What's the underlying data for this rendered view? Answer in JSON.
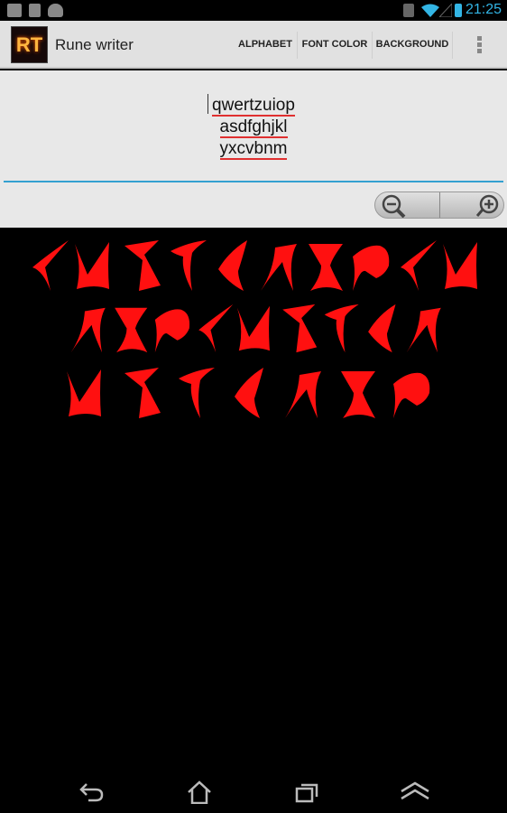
{
  "status_bar": {
    "time": "21:25",
    "icons": [
      "notes-icon",
      "sd-card-icon",
      "android-icon",
      "mute-icon",
      "wifi-icon",
      "signal-icon",
      "battery-charging-icon"
    ]
  },
  "action_bar": {
    "logo_text": "RT",
    "title": "Rune writer",
    "menu": [
      "ALPHABET",
      "FONT COLOR",
      "BACKGROUND"
    ],
    "overflow_icon": "more-vert-icon"
  },
  "editor": {
    "lines": [
      "qwertzuiop",
      "asdfghjkl",
      "yxcvbnm"
    ]
  },
  "zoom": {
    "out_icon": "zoom-out-icon",
    "in_icon": "zoom-in-icon"
  },
  "rune_output": {
    "color": "#ff1010",
    "background": "#000000"
  },
  "nav_bar": {
    "icons": [
      "back-icon",
      "home-icon",
      "recent-apps-icon",
      "menu-up-icon"
    ]
  }
}
